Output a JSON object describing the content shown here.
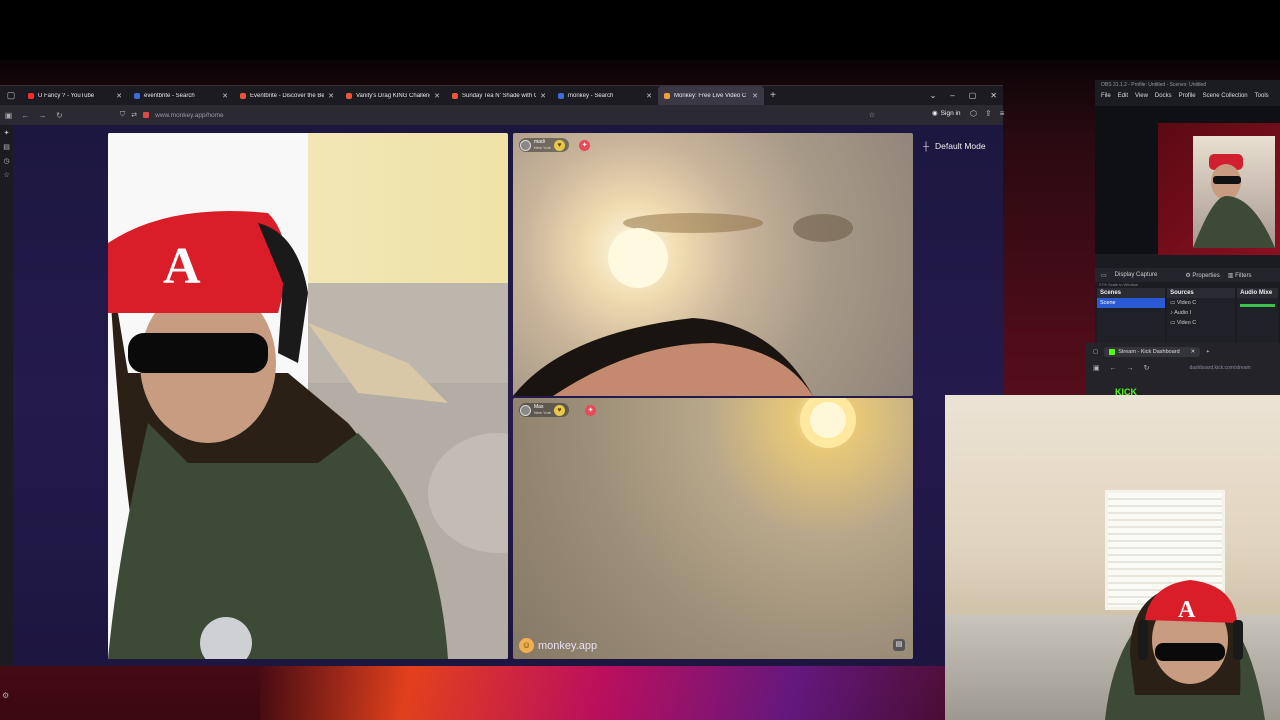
{
  "browser": {
    "tabs": [
      {
        "title": "U Fancy ? - YouTube",
        "color": "#ff2a2a",
        "active": false
      },
      {
        "title": "eventbrite - Search",
        "color": "#3a6bd8",
        "active": false
      },
      {
        "title": "Eventbrite - Discover the Best L",
        "color": "#f05537",
        "active": false
      },
      {
        "title": "Vanity's Drag KING Challenge T",
        "color": "#f05537",
        "active": false
      },
      {
        "title": "Sunday Tea N' Shade with ONS",
        "color": "#f05537",
        "active": false
      },
      {
        "title": "monkey - Search",
        "color": "#3a6bd8",
        "active": false
      },
      {
        "title": "Monkey: Free Live Video C",
        "color": "#f0a040",
        "active": true
      }
    ],
    "url": "www.monkey.app/home",
    "sign_in": "Sign in"
  },
  "monkey": {
    "default_mode": "Default Mode",
    "brand": "monkey.app",
    "match1": {
      "name": "madi",
      "location": "New York"
    },
    "match2": {
      "name": "Mas",
      "location": "New York"
    }
  },
  "obs": {
    "title": "OBS 31.1.2 - Profile: Untitled - Scenes: Untitled",
    "menu": [
      "File",
      "Edit",
      "View",
      "Docks",
      "Profile",
      "Scene Collection",
      "Tools"
    ],
    "zoom": "27%   Scale to Window",
    "capture_label": "Display Capture",
    "properties": "Properties",
    "filters": "Filters",
    "scenes_header": "Scenes",
    "scenes": [
      "Scene"
    ],
    "sources_header": "Sources",
    "sources": [
      "Video C",
      "Audio I",
      "Video C"
    ],
    "mixer_header": "Audio Mixe"
  },
  "kick": {
    "tab_title": "Stream - Kick Dashboard",
    "url": "dashboard.kick.com/stream",
    "logo": "KICK"
  }
}
